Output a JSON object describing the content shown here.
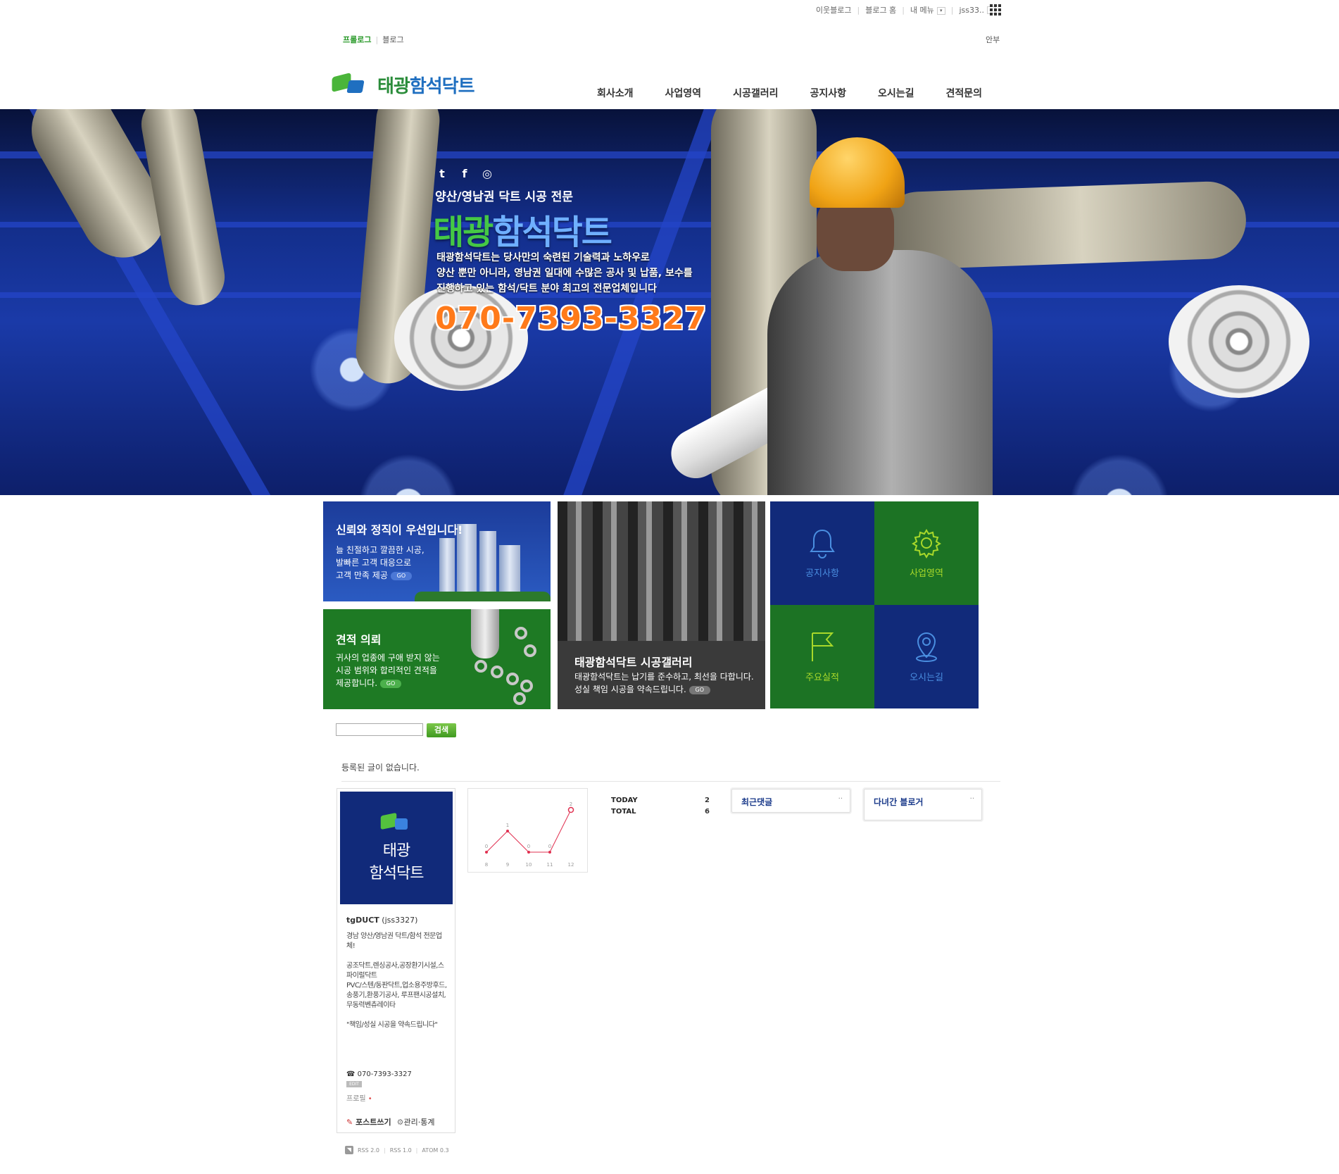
{
  "util": {
    "neighbor": "이웃블로그",
    "blog_home": "블로그 홈",
    "my_menu": "내 메뉴",
    "user": "jss33.."
  },
  "subnav": {
    "prologue": "프롤로그",
    "blog": "블로그",
    "help": "안부"
  },
  "logo": {
    "part1": "태광",
    "part2": "함석닥트"
  },
  "gnb": [
    "회사소개",
    "사업영역",
    "시공갤러리",
    "공지사항",
    "오시는길",
    "견적문의"
  ],
  "hero": {
    "subtitle": "양산/영남권 닥트 시공 전문",
    "title_part1": "태광",
    "title_part2": "함석닥트",
    "desc": "태광함석닥트는 당사만의 숙련된 기술력과 노하우로\n양산 뿐만 아니라, 영남권 일대에 수많은 공사 및 납품, 보수를\n진행하고 있는 함석/닥트 분야 최고의 전문업체입니다",
    "phone": "070-7393-3327"
  },
  "banners": {
    "trust": {
      "title": "신뢰와 정직이 우선입니다!",
      "text": "늘 친절하고 깔끔한 시공,\n발빠른 고객 대응으로\n고객 만족 제공",
      "go": "GO"
    },
    "estimate": {
      "title": "견적 의뢰",
      "text": "귀사의 업종에 구애 받지 않는\n시공 범위와 합리적인 견적을\n제공합니다.",
      "go": "GO"
    },
    "gallery": {
      "title": "태광함석닥트 시공갤러리",
      "text": "태광함석닥트는 납기를 준수하고, 최선을 다합니다.\n성실 책임 시공을 약속드립니다.",
      "go": "GO"
    }
  },
  "tiles": [
    {
      "label": "공지사항",
      "icon": "bell-icon",
      "color": "#112a7a"
    },
    {
      "label": "사업영역",
      "icon": "gear-icon",
      "color": "#1c7324"
    },
    {
      "label": "주요실적",
      "icon": "flag-icon",
      "color": "#1c7324"
    },
    {
      "label": "오시는길",
      "icon": "location-pin-icon",
      "color": "#112a7a"
    }
  ],
  "search": {
    "button": "검색",
    "value": ""
  },
  "no_posts": "등록된 글이 없습니다.",
  "profile": {
    "logo_line1": "태광",
    "logo_line2": "함석닥트",
    "name": "tgDUCT",
    "id": "(jss3327)",
    "desc": "경남 양산/영남권 닥트/함석 전문업체!\n\n공조닥트,렌싱공사,공장환기시설,스파이럴닥트\nPVC/스텐/동판닥트,업소용주방후드,송풍기,환풍기공사, 루프팬시공설치,무동력벤츄레이타\n\n\"책임/성실 시공을 약속드립니다\"",
    "phone": "☎ 070-7393-3327",
    "edit": "EDIT",
    "profile_link": "프로필",
    "write": "포스트쓰기",
    "manage": "관리·통계"
  },
  "feeds": [
    "RSS 2.0",
    "RSS 1.0",
    "ATOM 0.3"
  ],
  "visitor_chart": {
    "type": "line",
    "x": [
      8,
      9,
      10,
      11,
      12
    ],
    "values": [
      0,
      1,
      0,
      0,
      2
    ],
    "point_color": "#e03050"
  },
  "counter": {
    "today_label": "TODAY",
    "today": "2",
    "total_label": "TOTAL",
    "total": "6"
  },
  "recent_comments": {
    "title": "최근댓글",
    "more": "··"
  },
  "visited_bloggers": {
    "title": "다녀간 블로거",
    "more": "··"
  }
}
